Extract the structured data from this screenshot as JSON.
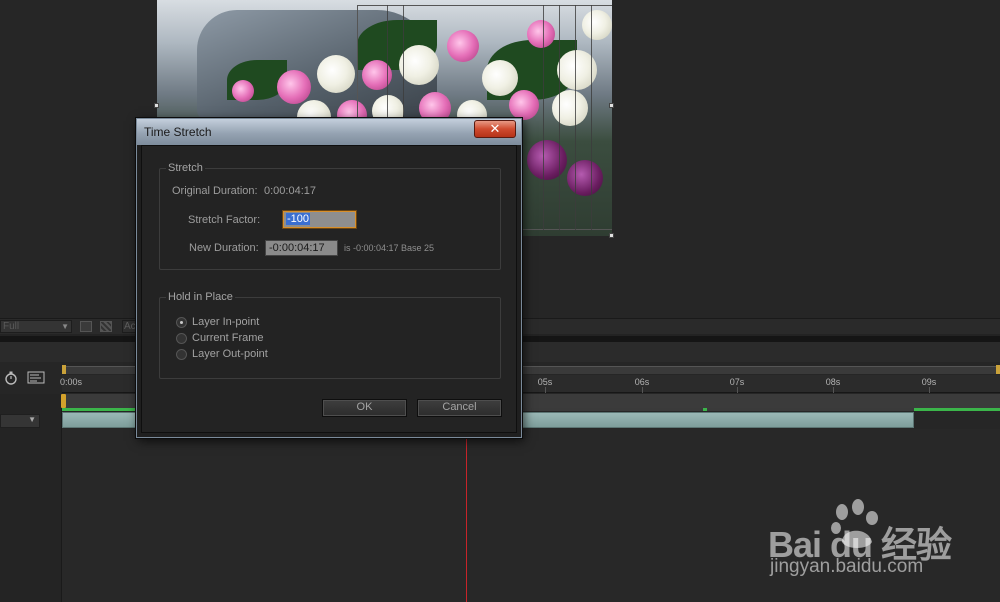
{
  "dialog": {
    "title": "Time Stretch",
    "close_glyph": "✕",
    "stretch_group": {
      "title": "Stretch",
      "original_duration_label": "Original Duration:",
      "original_duration_value": "0:00:04:17",
      "stretch_factor_label": "Stretch Factor:",
      "stretch_factor_value": "-100",
      "new_duration_label": "New Duration:",
      "new_duration_value": "-0:00:04:17",
      "new_duration_note": "is -0:00:04:17  Base 25"
    },
    "hold_group": {
      "title": "Hold in Place",
      "options": [
        {
          "label": "Layer In-point",
          "selected": true
        },
        {
          "label": "Current Frame",
          "selected": false
        },
        {
          "label": "Layer Out-point",
          "selected": false
        }
      ]
    },
    "ok_label": "OK",
    "cancel_label": "Cancel"
  },
  "viewer": {
    "resolution": "Full",
    "menu_label": "Ac"
  },
  "timeline": {
    "ticks": [
      "0:00s",
      "05s",
      "06s",
      "07s",
      "08s",
      "09s"
    ],
    "layer_color": "#8fb0ae",
    "playhead_color": "#c8242a",
    "work_area_color": "#3bb54a"
  },
  "watermark": {
    "logo": "Bai du 经验",
    "url": "jingyan.baidu.com"
  },
  "icons": [
    "stopwatch-icon",
    "motion-blur-icon",
    "close-icon",
    "chevron-down-icon",
    "baidu-paw-icon"
  ]
}
